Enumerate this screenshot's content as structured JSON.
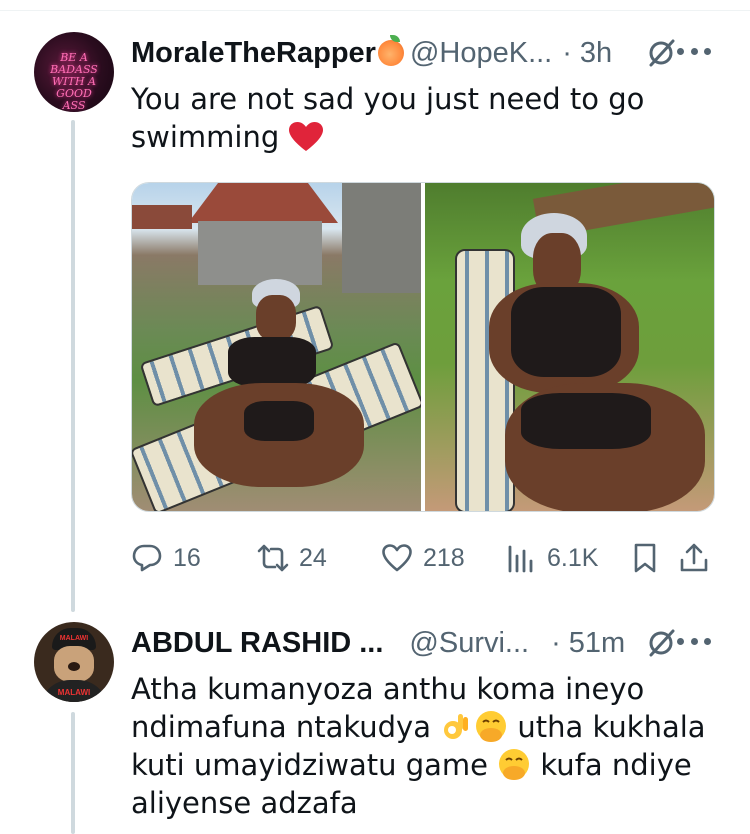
{
  "tweet": {
    "display_name": "MoraleTheRapper",
    "name_emoji": "peach-emoji",
    "handle": "@HopeK...",
    "separator": "·",
    "time": "3h",
    "text": "You are not sad you just need to go swimming",
    "text_emoji": "red-heart-emoji",
    "avatar_text": "BE A BADASS WITH A GOOD ASS",
    "images": [
      "woman-by-pool-lounger",
      "woman-on-striped-lounger"
    ],
    "stats": {
      "replies": "16",
      "retweets": "24",
      "likes": "218",
      "views": "6.1K"
    }
  },
  "reply": {
    "display_name": "ABDUL RASHID ...",
    "handle": "@Survi...",
    "separator": "·",
    "time": "51m",
    "avatar_text": "MALAWI",
    "text_parts": [
      "Atha kumanyoza anthu koma ineyo ndimafuna ntakudya ",
      " utha kukhala kuti umayidziwatu game ",
      " kufa ndiye aliyense adzafa"
    ],
    "emojis": [
      "ok-hand-emoji",
      "face-with-hand-over-mouth-emoji",
      "face-with-hand-over-mouth-emoji"
    ]
  },
  "colors": {
    "text": "#0f1419",
    "secondary": "#536471",
    "border": "#cfd9de",
    "heart": "#e0243a"
  }
}
